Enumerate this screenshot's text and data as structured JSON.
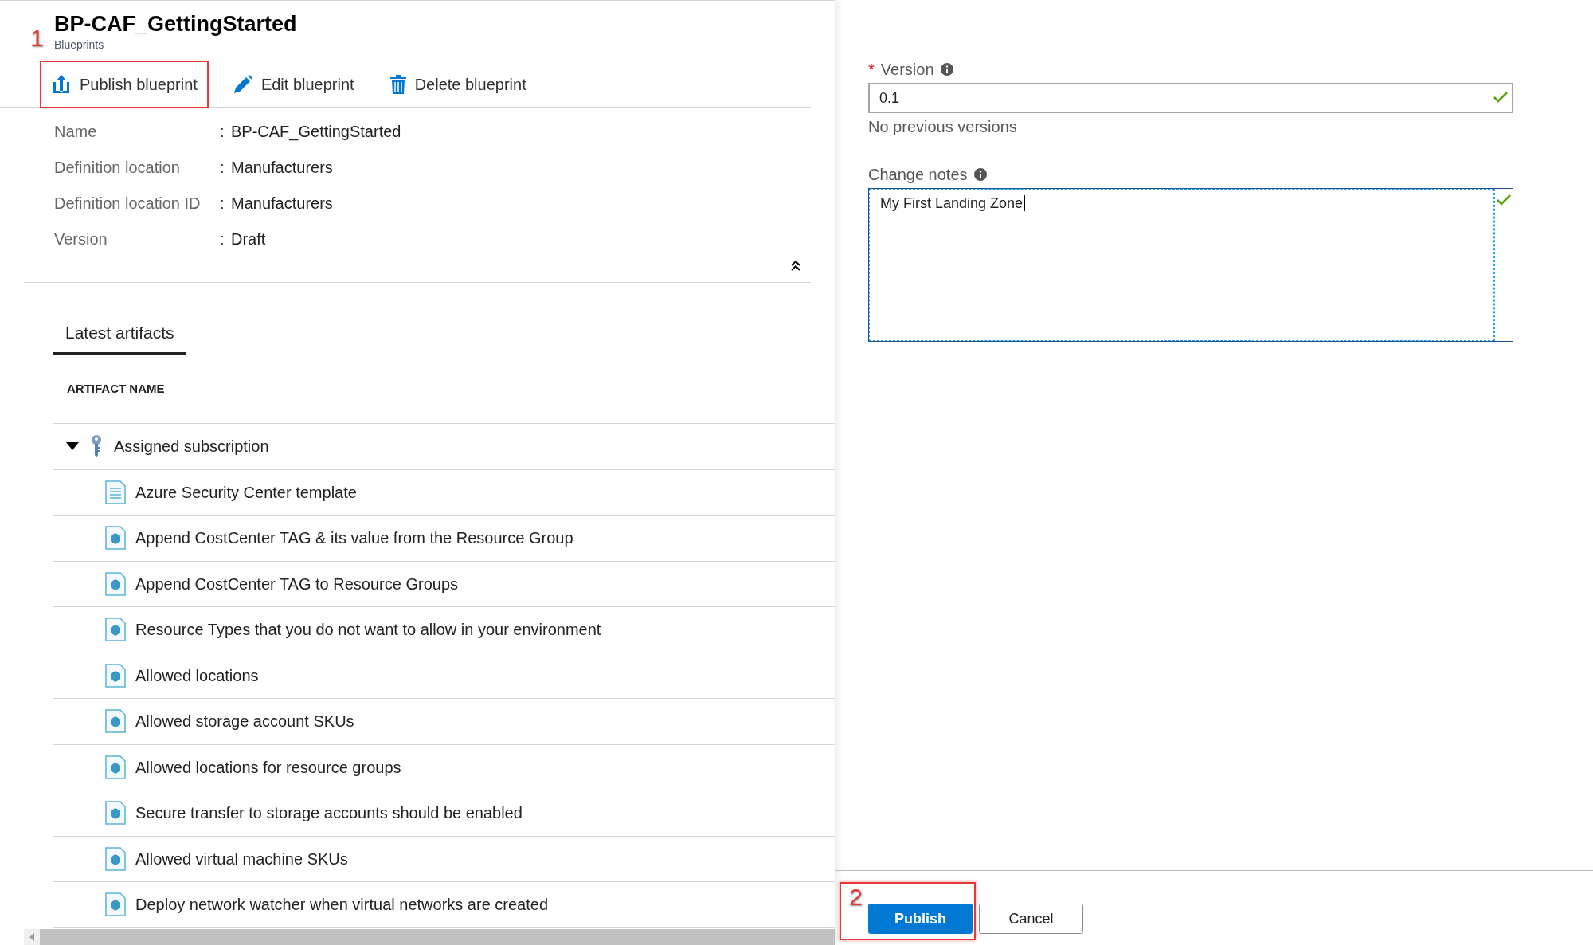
{
  "blueprint": {
    "callout": "1",
    "title": "BP-CAF_GettingStarted",
    "subtitle": "Blueprints"
  },
  "toolbar": [
    {
      "kind": "publish",
      "label": "Publish blueprint",
      "highlighted": true
    },
    {
      "kind": "edit",
      "label": "Edit blueprint",
      "highlighted": false
    },
    {
      "kind": "delete",
      "label": "Delete blueprint",
      "highlighted": false
    }
  ],
  "details": [
    {
      "label": "Name",
      "separator": ":",
      "value": "BP-CAF_GettingStarted"
    },
    {
      "label": "Definition location",
      "separator": ":",
      "value": "Manufacturers"
    },
    {
      "label": "Definition location ID",
      "separator": ":",
      "value": "Manufacturers"
    },
    {
      "label": "Version",
      "separator": ":",
      "value": "Draft"
    }
  ],
  "tabs": [
    {
      "label": "Latest artifacts",
      "selected": true
    }
  ],
  "table": {
    "columns": [
      "ARTIFACT NAME"
    ],
    "rows": [
      {
        "kind": "subscription",
        "name": "Assigned subscription",
        "expanded": true,
        "children": [
          {
            "kind": "template",
            "name": "Azure Security Center template"
          },
          {
            "kind": "policy",
            "name": "Append CostCenter TAG & its value from the Resource Group"
          },
          {
            "kind": "policy",
            "name": "Append CostCenter TAG to Resource Groups"
          },
          {
            "kind": "policy",
            "name": "Resource Types that you do not want to allow in your environment"
          },
          {
            "kind": "policy",
            "name": "Allowed locations"
          },
          {
            "kind": "policy",
            "name": "Allowed storage account SKUs"
          },
          {
            "kind": "policy",
            "name": "Allowed locations for resource groups"
          },
          {
            "kind": "policy",
            "name": "Secure transfer to storage accounts should be enabled"
          },
          {
            "kind": "policy",
            "name": "Allowed virtual machine SKUs"
          },
          {
            "kind": "policy",
            "name": "Deploy network watcher when virtual networks are created"
          }
        ]
      }
    ]
  },
  "publish_panel": {
    "version": {
      "label": "Version",
      "required_mark": "*",
      "value": "0.1",
      "valid": true,
      "hint": "No previous versions"
    },
    "change_notes": {
      "label": "Change notes",
      "value": "My First Landing Zone",
      "valid": true
    },
    "callout": "2",
    "buttons": [
      {
        "kind": "primary",
        "label": "Publish",
        "highlighted": true
      },
      {
        "kind": "secondary",
        "label": "Cancel",
        "highlighted": false
      }
    ]
  }
}
